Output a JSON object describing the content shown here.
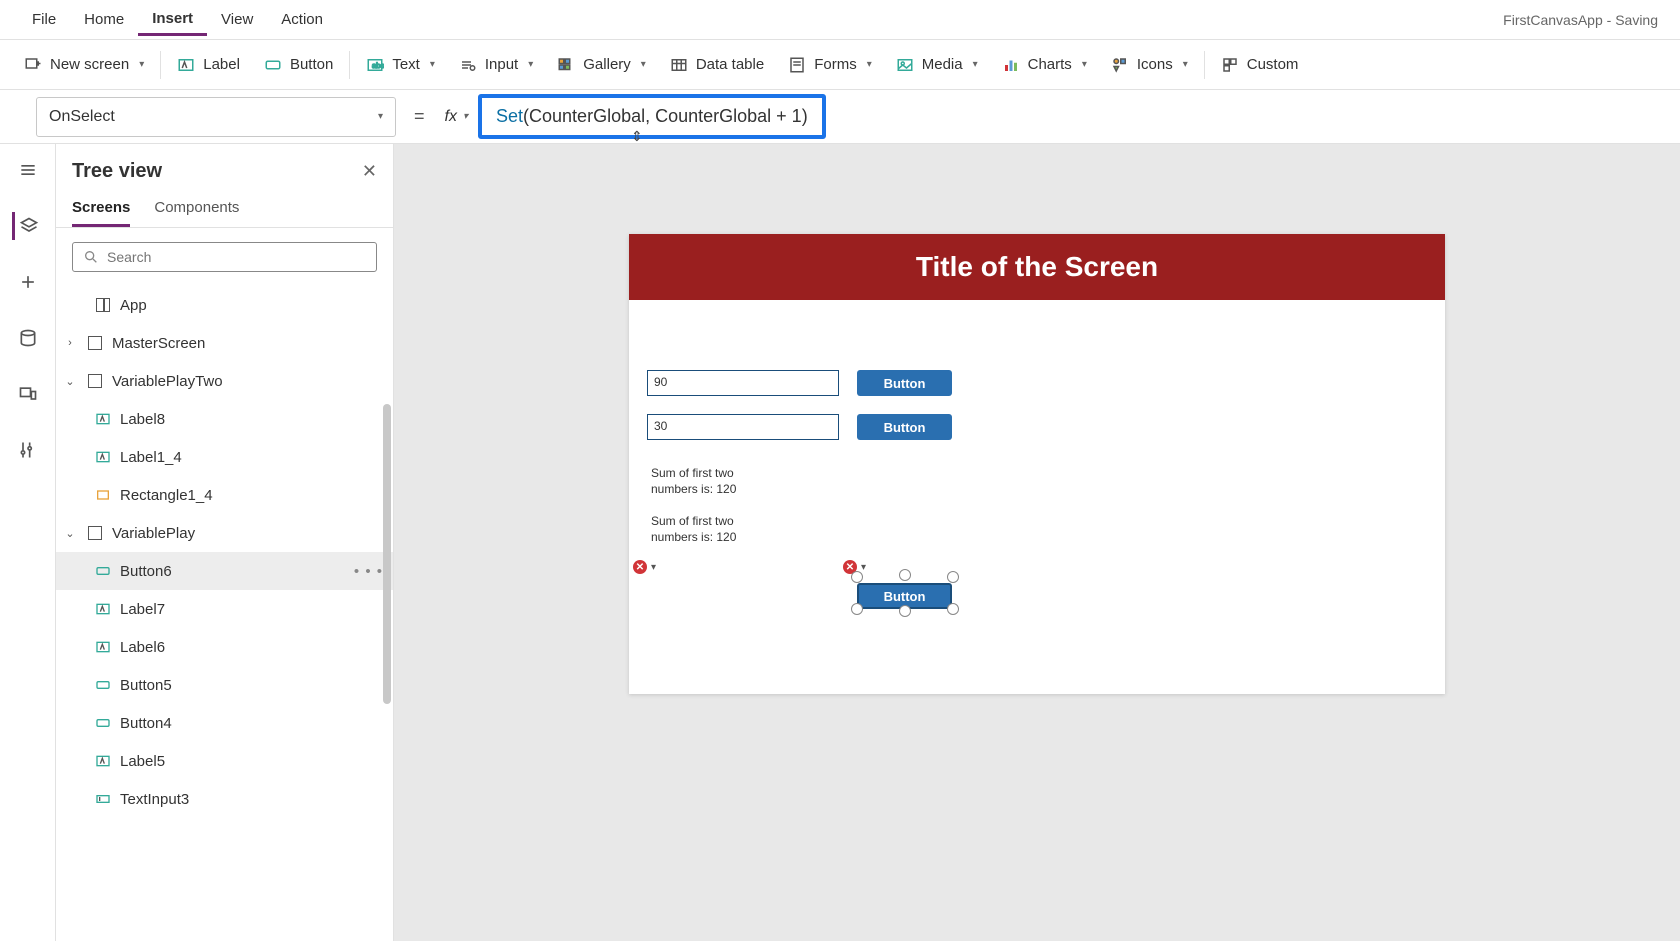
{
  "appStatus": "FirstCanvasApp - Saving",
  "menu": {
    "file": "File",
    "home": "Home",
    "insert": "Insert",
    "view": "View",
    "action": "Action"
  },
  "ribbon": {
    "newScreen": "New screen",
    "label": "Label",
    "button": "Button",
    "text": "Text",
    "input": "Input",
    "gallery": "Gallery",
    "dataTable": "Data table",
    "forms": "Forms",
    "media": "Media",
    "charts": "Charts",
    "icons": "Icons",
    "custom": "Custom"
  },
  "property": {
    "name": "OnSelect"
  },
  "formula": {
    "setKw": "Set",
    "body": "(CounterGlobal, CounterGlobal + 1)"
  },
  "tree": {
    "title": "Tree view",
    "tabScreens": "Screens",
    "tabComponents": "Components",
    "searchPlaceholder": "Search",
    "app": "App",
    "masterScreen": "MasterScreen",
    "variablePlayTwo": "VariablePlayTwo",
    "label8": "Label8",
    "label1_4": "Label1_4",
    "rectangle1_4": "Rectangle1_4",
    "variablePlay": "VariablePlay",
    "button6": "Button6",
    "label7": "Label7",
    "label6": "Label6",
    "button5": "Button5",
    "button4": "Button4",
    "label5": "Label5",
    "textInput3": "TextInput3"
  },
  "canvas": {
    "title": "Title of the Screen",
    "field1": "90",
    "field2": "30",
    "btnText": "Button",
    "sum1a": "Sum of first two",
    "sum1b": "numbers is: 120",
    "sum2a": "Sum of first two",
    "sum2b": "numbers is: 120"
  }
}
